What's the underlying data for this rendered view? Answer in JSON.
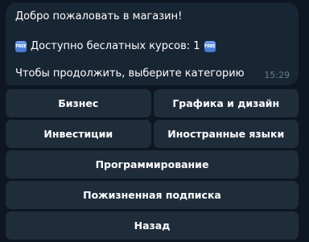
{
  "message": {
    "greeting": "Добро пожаловать в магазин!",
    "free_courses_text": "Доступно беслатных курсов: 1",
    "free_badge_text": "FREE",
    "prompt": "Чтобы продолжить, выберите категорию",
    "time": "15:29"
  },
  "keyboard": {
    "business": "Бизнес",
    "graphics_design": "Графика и дизайн",
    "investments": "Инвестиции",
    "foreign_languages": "Иностранные языки",
    "programming": "Программирование",
    "lifetime_subscription": "Пожизненная подписка",
    "back": "Назад"
  },
  "colors": {
    "background": "#0e1621",
    "bubble": "#182533",
    "button": "#1f2d3b",
    "time_text": "#6d7f8f",
    "free_badge": "#4a80e0"
  },
  "icons": [
    "free-emoji-icon"
  ]
}
